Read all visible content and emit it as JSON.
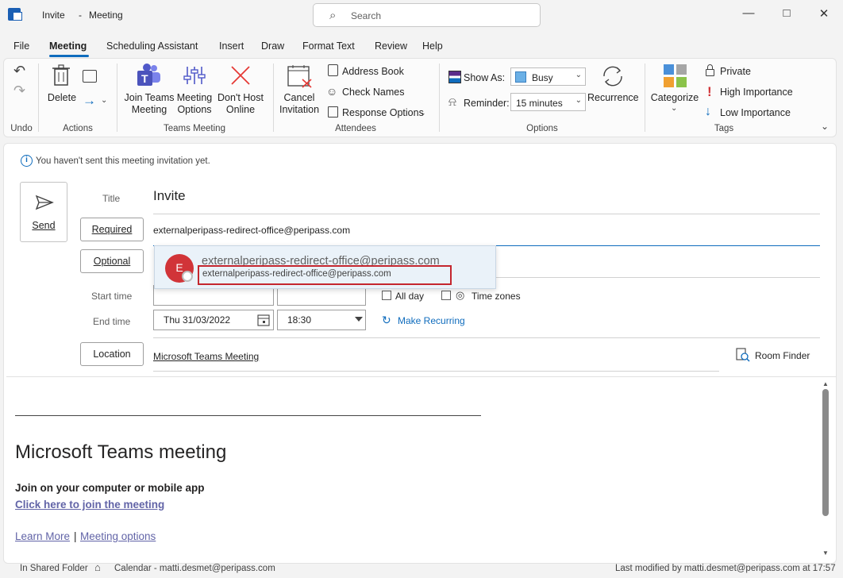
{
  "titlebar": {
    "window_title": "Invite",
    "dash": "-",
    "window_subtitle": "Meeting",
    "search_placeholder": "Search"
  },
  "menu": {
    "items": [
      "File",
      "Meeting",
      "Scheduling Assistant",
      "Insert",
      "Draw",
      "Format Text",
      "Review",
      "Help"
    ],
    "active": "Meeting"
  },
  "ribbon": {
    "undo_group": "Undo",
    "actions": {
      "delete": "Delete",
      "group": "Actions"
    },
    "teams": {
      "join_line1": "Join Teams",
      "join_line2": "Meeting",
      "options_line1": "Meeting",
      "options_line2": "Options",
      "donthost_line1": "Don't Host",
      "donthost_line2": "Online",
      "group": "Teams Meeting"
    },
    "attendees": {
      "cancel_line1": "Cancel",
      "cancel_line2": "Invitation",
      "address_book": "Address Book",
      "check_names": "Check Names",
      "response_options": "Response Options",
      "group": "Attendees"
    },
    "options": {
      "show_as_label": "Show As:",
      "show_as_value": "Busy",
      "reminder_label": "Reminder:",
      "reminder_value": "15 minutes",
      "recurrence": "Recurrence",
      "group": "Options"
    },
    "tags": {
      "categorize": "Categorize",
      "private": "Private",
      "high_importance": "High Importance",
      "low_importance": "Low Importance",
      "group": "Tags",
      "colors": {
        "high": "#d13438",
        "low": "#0f6cbd"
      }
    }
  },
  "form": {
    "info_text": "You haven't sent this meeting invitation yet.",
    "send": "Send",
    "title_label": "Title",
    "title_value": "Invite",
    "required": "Required",
    "required_value": "externalperipass-redirect-office@peripass.com",
    "optional": "Optional",
    "start_time_label": "Start time",
    "end_time_label": "End time",
    "end_date": "Thu 31/03/2022",
    "end_time": "18:30",
    "all_day": "All day",
    "time_zones": "Time zones",
    "make_recurring": "Make Recurring",
    "location": "Location",
    "location_value": "Microsoft Teams Meeting",
    "room_finder": "Room Finder"
  },
  "suggestion": {
    "avatar_letter": "E",
    "name": "externalperipass-redirect-office@peripass.com",
    "email": "externalperipass-redirect-office@peripass.com"
  },
  "body": {
    "heading": "Microsoft Teams meeting",
    "join_label": "Join on your computer or mobile app",
    "join_link": "Click here to join the meeting",
    "learn_more": "Learn More",
    "pipe": "|",
    "meeting_options": "Meeting options"
  },
  "status": {
    "folder": "In Shared Folder",
    "calendar": "Calendar - matti.desmet@peripass.com",
    "modified": "Last modified by matti.desmet@peripass.com at 17:57"
  }
}
